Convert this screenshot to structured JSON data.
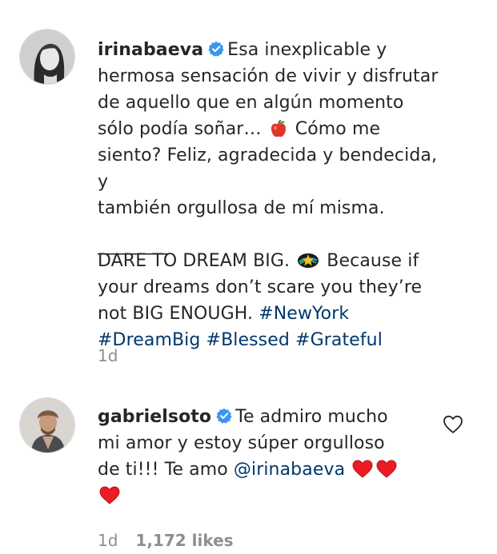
{
  "comments": [
    {
      "username": "irinabaeva",
      "verified": true,
      "line1": "Esa inexplicable y",
      "line2": "hermosa sensación de vivir y disfrutar",
      "line3": "de aquello que en algún momento",
      "line4a": "sólo podía soñar…",
      "line4b": "Cómo me",
      "line5": "siento? Feliz, agradecida y bendecida, y",
      "line6": "también orgullosa de mí misma.",
      "separator": "________",
      "line8a": "DARE TO DREAM BIG.",
      "line8b": "Because if",
      "line9": "your dreams don’t scare you they’re",
      "line10": "not BIG ENOUGH.",
      "hashtags": [
        "#NewYork",
        "#DreamBig",
        "#Blessed",
        "#Grateful"
      ],
      "time": "1d",
      "emojis": [
        "apple-icon",
        "star-rainbow-icon"
      ]
    },
    {
      "username": "gabrielsoto",
      "verified": true,
      "line1": "Te admiro mucho",
      "line2": "mi amor y estoy súper orgulloso",
      "line3": "de ti!!! Te amo",
      "mention": "@irinabaeva",
      "time": "1d",
      "likes": "1,172 likes",
      "emojis": [
        "heart-icon",
        "heart-icon",
        "heart-icon"
      ]
    }
  ],
  "colors": {
    "text": "#262626",
    "muted": "#8e8e8e",
    "link": "#00376b",
    "verified": "#3897f0",
    "heart": "#ed4956"
  }
}
